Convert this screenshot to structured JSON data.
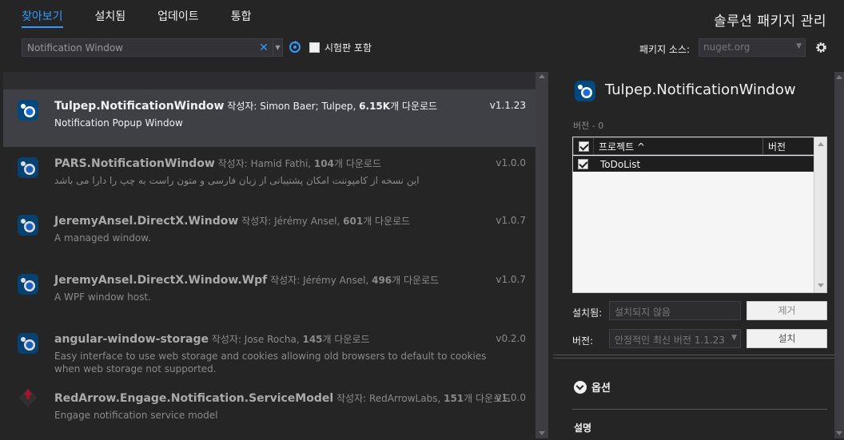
{
  "header": {
    "tabs": [
      {
        "label": "찾아보기",
        "active": true
      },
      {
        "label": "설치됨",
        "active": false
      },
      {
        "label": "업데이트",
        "active": false
      },
      {
        "label": "통합",
        "active": false
      }
    ],
    "title": "솔루션 패키지 관리",
    "search": {
      "value": "Notification Window",
      "placeholder": ""
    },
    "prerelease_label": "시험판 포함",
    "source_label": "패키지 소스:",
    "source_value": "nuget.org"
  },
  "packages": [
    {
      "name": "Tulpep.NotificationWindow",
      "author_prefix": "작성자:",
      "author": "Simon Baer; Tulpep,",
      "downloads": "6.15K",
      "downloads_suffix": "개 다운로드",
      "description": "Notification Popup Window",
      "version": "v1.1.23",
      "icon": "nuget-package-icon"
    },
    {
      "name": "PARS.NotificationWindow",
      "author_prefix": "작성자:",
      "author": "Hamid Fathi,",
      "downloads": "104",
      "downloads_suffix": "개 다운로드",
      "description": "این نسخه از کامپوننت امکان پشتیبانی از زبان فارسی و متون راست به چپ را دارا می باشد",
      "version": "v1.0.0",
      "icon": "nuget-package-icon"
    },
    {
      "name": "JeremyAnsel.DirectX.Window",
      "author_prefix": "작성자:",
      "author": "Jérémy Ansel,",
      "downloads": "601",
      "downloads_suffix": "개 다운로드",
      "description": "A managed window.",
      "version": "v1.0.7",
      "icon": "nuget-package-icon"
    },
    {
      "name": "JeremyAnsel.DirectX.Window.Wpf",
      "author_prefix": "작성자:",
      "author": "Jérémy Ansel,",
      "downloads": "496",
      "downloads_suffix": "개 다운로드",
      "description": "A WPF window host.",
      "version": "v1.0.7",
      "icon": "nuget-package-icon"
    },
    {
      "name": "angular-window-storage",
      "author_prefix": "작성자:",
      "author": "Jose Rocha,",
      "downloads": "145",
      "downloads_suffix": "개 다운로드",
      "description": "Easy interface to use web storage and cookies allowing old browsers to default to cookies when web storage not supported.",
      "version": "v0.2.0",
      "icon": "nuget-package-icon"
    },
    {
      "name": "RedArrow.Engage.Notification.ServiceModel",
      "author_prefix": "작성자:",
      "author": "RedArrowLabs,",
      "downloads": "151",
      "downloads_suffix": "개 다운로드",
      "description": "Engage notification service model",
      "version": "v1.0.0",
      "icon": "red-arrow-package-icon"
    }
  ],
  "detail": {
    "title": "Tulpep.NotificationWindow",
    "version_line": "버전 - 0",
    "project_header": "프로젝트 ^",
    "version_header": "버전",
    "projects": [
      {
        "name": "ToDoList",
        "checked": true
      }
    ],
    "installed_label": "설치됨:",
    "installed_value": "설치되지 않음",
    "remove_label": "제거",
    "version_label": "버전:",
    "version_value": "안정적인 최신 버전 1.1.23",
    "install_label": "설치",
    "options_label": "옵션",
    "description_label": "설명"
  },
  "colors": {
    "accent": "#3399ff",
    "background": "#252526",
    "selected": "#3f3f46"
  }
}
